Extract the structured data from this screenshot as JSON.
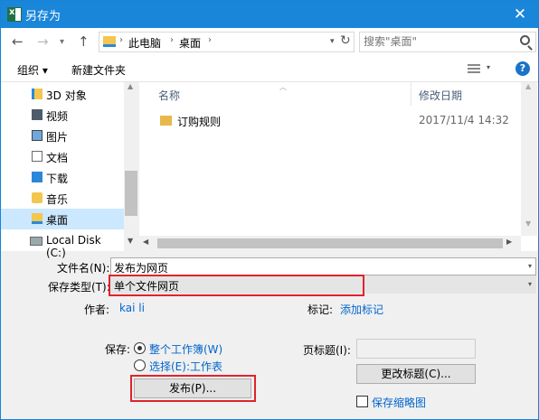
{
  "window": {
    "title": "另存为",
    "close": "✕"
  },
  "nav": {
    "back": "←",
    "forward": "→",
    "up": "↑",
    "refresh": "↻",
    "separator": "›",
    "breadcrumb": [
      "此电脑",
      "桌面"
    ],
    "search_placeholder": "搜索\"桌面\""
  },
  "toolbar": {
    "organize": "组织 ▾",
    "new_folder": "新建文件夹",
    "help": "?"
  },
  "tree": [
    {
      "label": "3D 对象",
      "icon": "3d-objects-icon",
      "selected": false
    },
    {
      "label": "视频",
      "icon": "video-icon",
      "selected": false
    },
    {
      "label": "图片",
      "icon": "pictures-icon",
      "selected": false
    },
    {
      "label": "文档",
      "icon": "documents-icon",
      "selected": false
    },
    {
      "label": "下载",
      "icon": "downloads-icon",
      "selected": false
    },
    {
      "label": "音乐",
      "icon": "music-icon",
      "selected": false
    },
    {
      "label": "桌面",
      "icon": "desktop-icon",
      "selected": true
    },
    {
      "label": "Local Disk (C:)",
      "icon": "disk-icon",
      "selected": false
    }
  ],
  "filelist": {
    "columns": {
      "name": "名称",
      "date": "修改日期"
    },
    "files": [
      {
        "name": "订购规则",
        "date": "2017/11/4 14:32",
        "icon": "folder-icon"
      }
    ]
  },
  "form": {
    "filename_label": "文件名(N):",
    "filename_value": "发布为网页",
    "filetype_label": "保存类型(T):",
    "filetype_value": "单个文件网页",
    "author_label": "作者:",
    "author_value": "kai li",
    "tags_label": "标记:",
    "tags_value": "添加标记",
    "save_label": "保存:",
    "save_option_workbook": "整个工作簿(W)",
    "save_option_selection": "选择(E):工作表",
    "publish_button": "发布(P)...",
    "page_title_label": "页标题(I):",
    "page_title_value": "",
    "change_title_button": "更改标题(C)...",
    "save_thumbnail": "保存缩略图"
  },
  "colors": {
    "titlebar": "#1a86d9",
    "highlight": "#e0232c",
    "link": "#0066cc"
  }
}
